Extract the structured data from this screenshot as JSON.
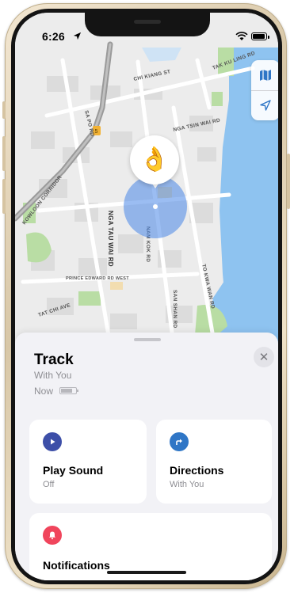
{
  "status_bar": {
    "time": "6:26"
  },
  "map": {
    "street_labels": [
      "CHI KIANG ST",
      "TAK KU LING RD",
      "SA PO RD",
      "KOWLOON CORRIDOR",
      "NGA TSIN WAI RD",
      "NGA TAU WAI RD",
      "NAM KOK RD",
      "PRINCE EDWARD RD WEST",
      "TAT CHI AVE",
      "SAN SHAN RD",
      "TO KWA WAN RD"
    ],
    "item_glyph": "👌",
    "controls": {
      "map_type_icon": "map-icon",
      "locate_icon": "location-arrow-icon"
    }
  },
  "sheet": {
    "title": "Track",
    "owner": "With You",
    "last_seen": "Now",
    "close_symbol": "✕",
    "cards": {
      "play_sound": {
        "label": "Play Sound",
        "status": "Off",
        "icon": "play-icon",
        "color": "#3d4fa8"
      },
      "directions": {
        "label": "Directions",
        "status": "With You",
        "icon": "directions-icon",
        "color": "#2f76c6"
      },
      "notifications": {
        "label": "Notifications",
        "icon": "bell-icon",
        "color": "#f0455c"
      }
    }
  },
  "colors": {
    "water": "#8ec3f0",
    "land": "#ececec",
    "park": "#b9dda4",
    "road_main": "#9a9a9a",
    "accuracy": "#4887e8"
  }
}
